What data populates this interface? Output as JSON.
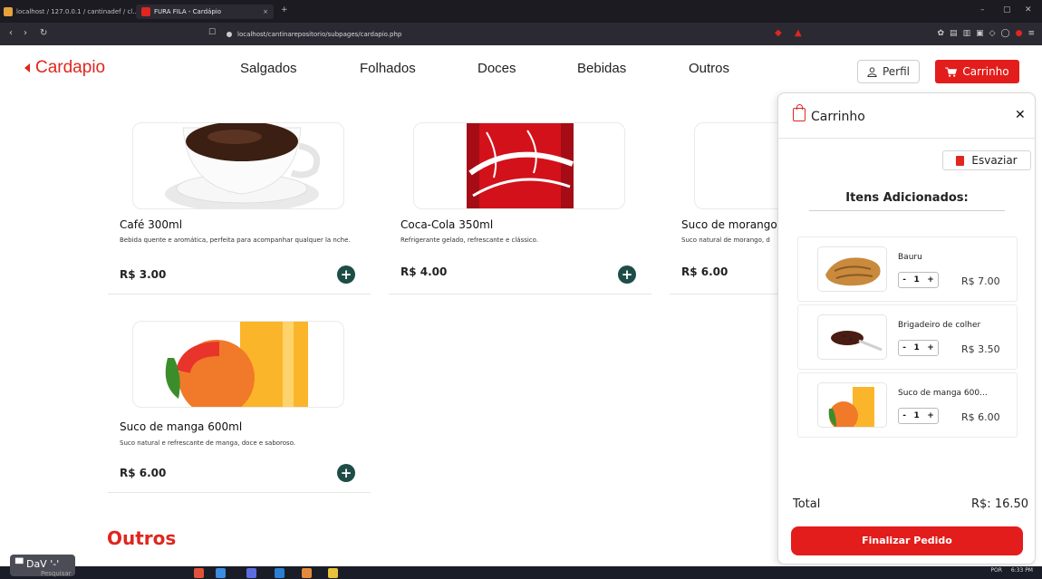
{
  "browser": {
    "tabs": [
      {
        "label": "localhost / 127.0.0.1 / cantinadef / cl..."
      },
      {
        "label": "FURA FILA - Cardápio"
      }
    ],
    "url": "localhost/cantinarepositorio/subpages/cardapio.php"
  },
  "header": {
    "brand": "Cardapio",
    "nav": [
      "Salgados",
      "Folhados",
      "Doces",
      "Bebidas",
      "Outros"
    ],
    "perfil_label": "Perfil",
    "carrinho_label": "Carrinho"
  },
  "products": [
    {
      "name": "Café 300ml",
      "desc": "Bebida quente e aromática, perfeita para acompanhar qualquer la nche.",
      "price": "R$ 3.00"
    },
    {
      "name": "Coca-Cola 350ml",
      "desc": "Refrigerante gelado, refrescante e clássico.",
      "price": "R$ 4.00"
    },
    {
      "name": "Suco de morango",
      "desc": "Suco natural de morango, d",
      "price": "R$ 6.00"
    },
    {
      "name": "Suco de manga 600ml",
      "desc": "Suco natural e refrescante de manga, doce e saboroso.",
      "price": "R$ 6.00"
    }
  ],
  "section_title": "Outros",
  "cart": {
    "title": "Carrinho",
    "clear_label": "Esvaziar",
    "items_title": "Itens Adicionados:",
    "items": [
      {
        "name": "Bauru",
        "qty": "1",
        "price": "R$ 7.00"
      },
      {
        "name": "Brigadeiro de colher",
        "qty": "1",
        "price": "R$ 3.50"
      },
      {
        "name": "Suco de manga 600...",
        "qty": "1",
        "price": "R$ 6.00"
      }
    ],
    "total_label": "Total",
    "total_value": "R$: 16.50",
    "checkout_label": "Finalizar Pedido"
  },
  "taskbar": {
    "dav_label": "DaV '-'",
    "search_placeholder": "Pesquisar",
    "lang": "POR",
    "time": "6:33 PM"
  },
  "colors": {
    "brand_red": "#e21d1b",
    "add_button": "#1e4d47"
  }
}
